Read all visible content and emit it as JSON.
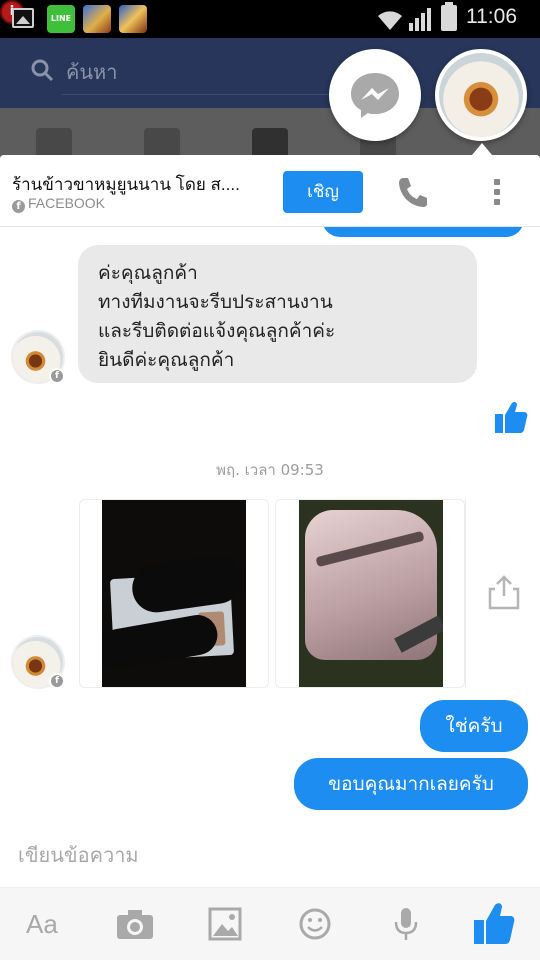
{
  "status_bar": {
    "time": "11:06",
    "notification_icons": [
      "gallery-icon",
      "line-app-icon",
      "game-icon",
      "game-icon",
      "alert-icon"
    ],
    "line_label": "LINE",
    "alert_label": "i"
  },
  "facebook": {
    "search_placeholder": "ค้นหา"
  },
  "chat": {
    "title": "ร้านข้าวขาหมูยูนนาน โดย ส....",
    "source": "FACEBOOK",
    "invite_label": "เชิญ"
  },
  "messages": {
    "incoming_text": [
      "ค่ะคุณลูกค้า",
      "ทางทีมงานจะรีบประสานงาน",
      "และรีบติดต่อแจ้งคุณลูกค้าค่ะ",
      "ยินดีค่ะคุณลูกค้า"
    ],
    "timestamp": "พฤ. เวลา 09:53",
    "outgoing": [
      "ใช่ครับ",
      "ขอบคุณมากเลยครับ"
    ]
  },
  "composer": {
    "placeholder": "เขียนข้อความ",
    "text_tool_label": "Aa"
  },
  "colors": {
    "accent": "#1e8df2",
    "incoming_bubble": "#e9e9e9"
  }
}
